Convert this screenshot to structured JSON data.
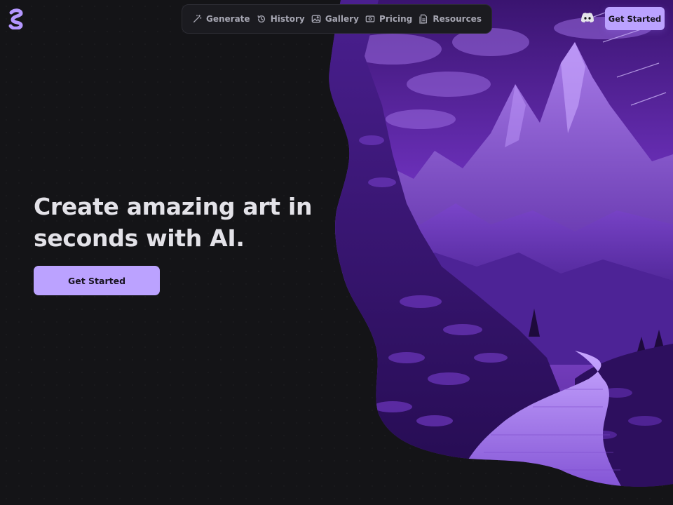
{
  "brand": {
    "logo_icon": "stripe-s-logo-icon",
    "accent": "#bba2ff",
    "background": "#141417"
  },
  "nav": {
    "items": [
      {
        "label": "Generate",
        "icon": "magic-wand-icon"
      },
      {
        "label": "History",
        "icon": "history-icon"
      },
      {
        "label": "Gallery",
        "icon": "image-icon"
      },
      {
        "label": "Pricing",
        "icon": "money-icon"
      },
      {
        "label": "Resources",
        "icon": "document-icon"
      }
    ]
  },
  "header": {
    "discord_icon": "discord-icon",
    "cta_label": "Get Started"
  },
  "hero": {
    "headline_line1": "Create amazing art in",
    "headline_line2": "seconds with AI.",
    "cta_label": "Get Started",
    "image_alt": "purple mountain landscape with a winding stone path"
  }
}
